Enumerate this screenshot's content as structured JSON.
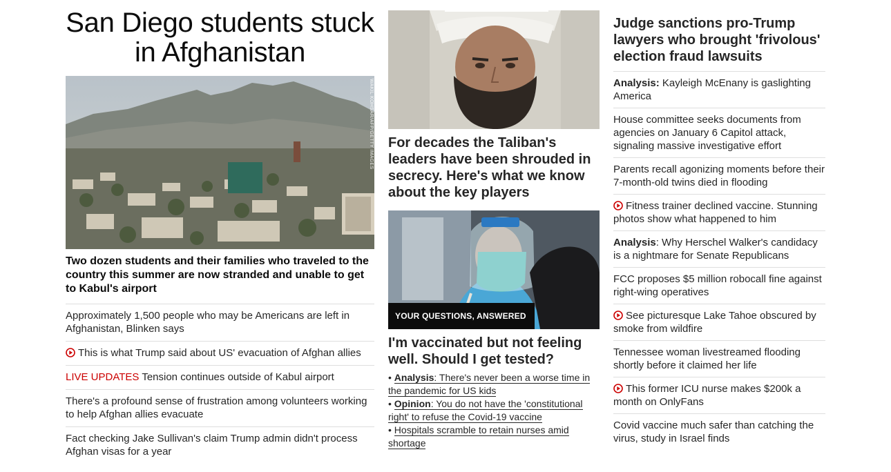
{
  "col1": {
    "headline": "San Diego students stuck in Afghanistan",
    "image_credit": "WAKIL KOHSAR/AFP/GETTY IMAGES",
    "lead": "Two dozen students and their families who traveled to the country this summer are now stranded and unable to get to Kabul's airport",
    "stories": [
      {
        "text": "Approximately 1,500 people who may be Americans are left in Afghanistan, Blinken says"
      },
      {
        "text": "This is what Trump said about US' evacuation of Afghan allies",
        "icon": "play-icon"
      },
      {
        "label": "LIVE UPDATES",
        "text": " Tension continues outside of Kabul airport"
      },
      {
        "text": "There's a profound sense of frustration among volunteers working to help Afghan allies evacuate"
      },
      {
        "text": "Fact checking Jake Sullivan's claim Trump admin didn't process Afghan visas for a year"
      }
    ]
  },
  "col2": {
    "headline1": "For decades the Taliban's leaders have been shrouded in secrecy. Here's what we know about the key players",
    "badge": "YOUR QUESTIONS, ANSWERED",
    "headline2": "I'm vaccinated but not feeling well. Should I get tested?",
    "bullets": [
      {
        "label": "Analysis",
        "text": ": There's never been a worse time in the pandemic for US kids"
      },
      {
        "label": "Opinion",
        "text": ": You do not have the 'constitutional right' to refuse the Covid-19 vaccine"
      },
      {
        "label": "",
        "text": "Hospitals scramble to retain nurses amid shortage"
      }
    ]
  },
  "col3": {
    "headline": "Judge sanctions pro-Trump lawyers who brought 'frivolous' election fraud lawsuits",
    "stories": [
      {
        "label": "Analysis:",
        "text": " Kayleigh McEnany is gaslighting America"
      },
      {
        "text": "House committee seeks documents from agencies on January 6 Capitol attack, signaling massive investigative effort"
      },
      {
        "text": "Parents recall agonizing moments before their 7-month-old twins died in flooding"
      },
      {
        "text": "Fitness trainer declined vaccine. Stunning photos show what happened to him",
        "icon": "play-icon"
      },
      {
        "label": "Analysis",
        "text": ": Why Herschel Walker's candidacy is a nightmare for Senate Republicans"
      },
      {
        "text": "FCC proposes $5 million robocall fine against right-wing operatives"
      },
      {
        "text": "See picturesque Lake Tahoe obscured by smoke from wildfire",
        "icon": "play-icon"
      },
      {
        "text": "Tennessee woman livestreamed flooding shortly before it claimed her life"
      },
      {
        "text": "This former ICU nurse makes $200k a month on OnlyFans",
        "icon": "play-icon"
      },
      {
        "text": "Covid vaccine much safer than catching the virus, study in Israel finds"
      }
    ]
  },
  "colors": {
    "live_label": "#cc0000",
    "play_icon": "#cc0000",
    "badge_bg": "#0c0c0c"
  }
}
